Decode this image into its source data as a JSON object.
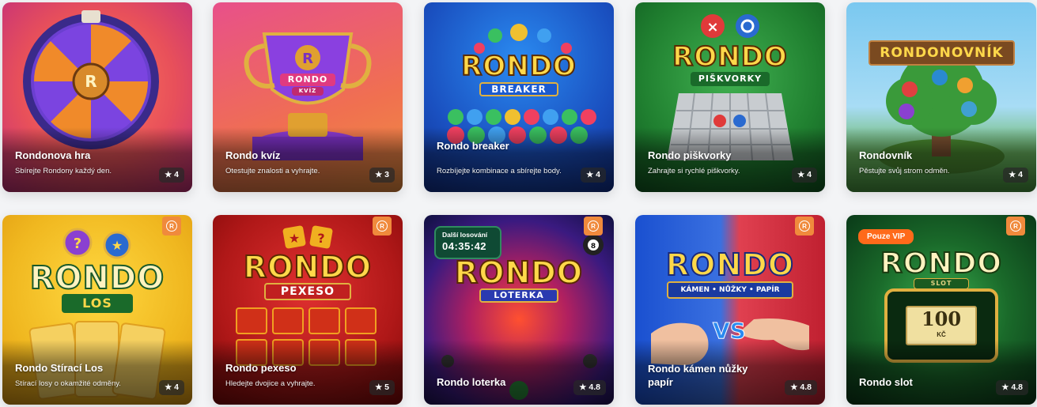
{
  "games": [
    {
      "title": "Rondonova hra",
      "description": "Sbírejte Rondony každý den.",
      "rating": "4"
    },
    {
      "title": "Rondo kvíz",
      "description": "Otestujte znalosti a vyhrajte.",
      "rating": "3"
    },
    {
      "title": "Rondo breaker",
      "description": "Rozbíjejte kombinace a sbírejte body.",
      "rating": "4"
    },
    {
      "title": "Rondo piškvorky",
      "description": "Zahrajte si rychlé piškvorky.",
      "rating": "4"
    },
    {
      "title": "Rondovník",
      "description": "Pěstujte svůj strom odměn.",
      "rating": "4"
    },
    {
      "title": "Rondo Stírací Los",
      "description": "Stírací losy o okamžité odměny.",
      "rating": "4"
    },
    {
      "title": "Rondo pexeso",
      "description": "Hledejte dvojice a vyhrajte.",
      "rating": "5"
    },
    {
      "title": "Rondo loterka",
      "description": "",
      "rating": "4.8"
    },
    {
      "title": "Rondo kámen nůžky papír",
      "description": "",
      "rating": "4.8"
    },
    {
      "title": "Rondo slot",
      "description": "",
      "rating": "4.8"
    }
  ],
  "art_text": {
    "kviz_main": "RONDO",
    "kviz_sub": "KVÍZ",
    "breaker_main": "RONDO",
    "breaker_sub": "BREAKER",
    "piskvorky_main": "RONDO",
    "piskvorky_sub": "PIŠKVORKY",
    "rondovnik_main": "RONDONOVNÍK",
    "los_main": "RONDO",
    "los_sub": "LOS",
    "pexeso_main": "RONDO",
    "pexeso_sub": "PEXESO",
    "loterka_main": "RONDO",
    "loterka_sub": "LOTERKA",
    "kamen_main": "RONDO",
    "kamen_sub": "KÁMEN • NŮŽKY • PAPÍR",
    "kamen_vs": "VS",
    "slot_main": "RONDO",
    "slot_sub": "SLOT",
    "slot_ticket": "100",
    "slot_ticket_unit": "KČ"
  },
  "loterka_timer": {
    "label": "Další losování",
    "value": "04:35:42"
  },
  "vip_badge": "Pouze VIP",
  "rondo_badge_letter": "R",
  "star_glyph": "★",
  "colors": {
    "accent_orange": "#f08a3c",
    "vip_orange": "#ff6a1a"
  }
}
